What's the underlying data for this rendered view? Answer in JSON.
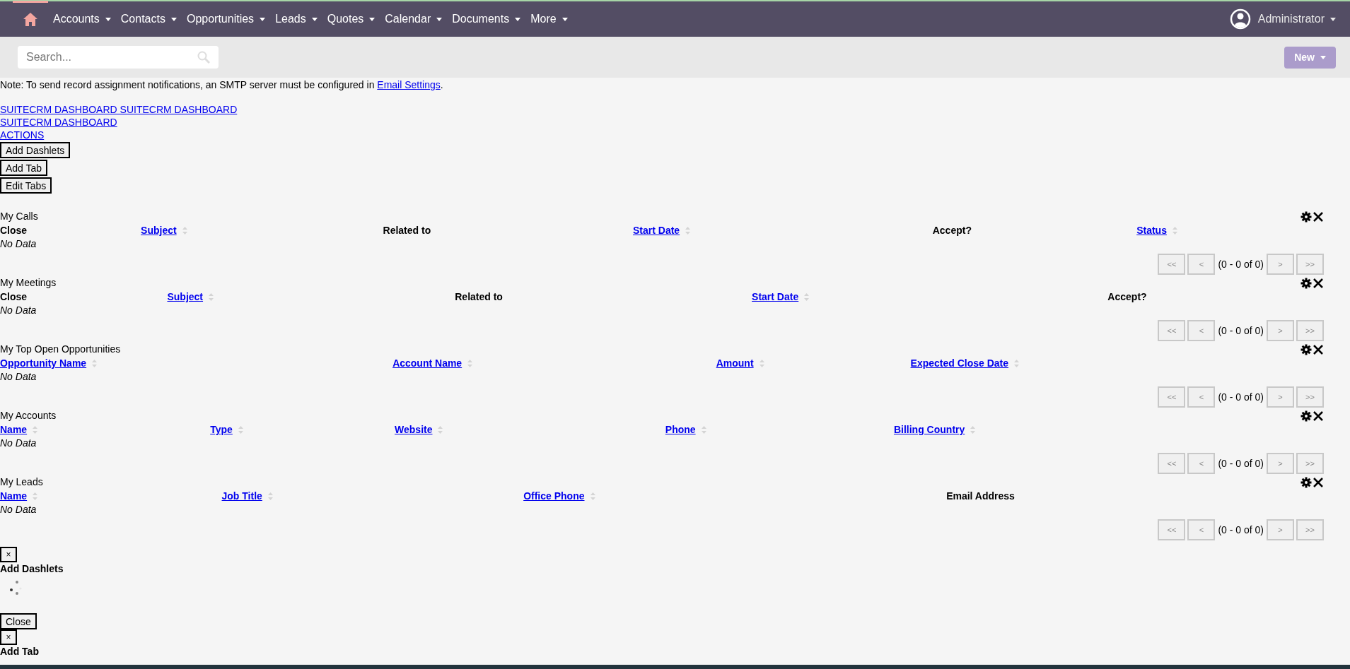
{
  "nav": {
    "items": [
      {
        "label": "Accounts"
      },
      {
        "label": "Contacts"
      },
      {
        "label": "Opportunities"
      },
      {
        "label": "Leads"
      },
      {
        "label": "Quotes"
      },
      {
        "label": "Calendar"
      },
      {
        "label": "Documents"
      },
      {
        "label": "More"
      }
    ],
    "user": "Administrator"
  },
  "toolbar": {
    "search": {
      "placeholder": "Search..."
    },
    "new_button": "New"
  },
  "notice": {
    "text": "Note: To send record assignment notifications, an SMTP server must be configured in ",
    "link": "Email Settings",
    "end": "."
  },
  "links": [
    "SUITECRM DASHBOARD SUITECRM DASHBOARD",
    "SUITECRM DASHBOARD",
    "ACTIONS"
  ],
  "buttons": [
    "Add Dashlets",
    "Add Tab",
    "Edit Tabs"
  ],
  "dashlets": [
    {
      "title": "My Calls",
      "columns": [
        {
          "label": "Close",
          "kind": "plain"
        },
        {
          "label": "Subject",
          "kind": "sortable"
        },
        {
          "label": "Related to",
          "kind": "plain"
        },
        {
          "label": "Start Date",
          "kind": "sortable"
        },
        {
          "label": "Accept?",
          "kind": "plain"
        },
        {
          "label": "Status",
          "kind": "sortable"
        }
      ],
      "empty": "No Data",
      "pager": {
        "first": "<<",
        "prev": "<",
        "range": "(0 - 0 of 0)",
        "next": ">",
        "last": ">>"
      }
    },
    {
      "title": "My Meetings",
      "columns": [
        {
          "label": "Close",
          "kind": "plain"
        },
        {
          "label": "Subject",
          "kind": "sortable"
        },
        {
          "label": "Related to",
          "kind": "plain"
        },
        {
          "label": "Start Date",
          "kind": "sortable"
        },
        {
          "label": "Accept?",
          "kind": "plain"
        }
      ],
      "empty": "No Data",
      "pager": {
        "first": "<<",
        "prev": "<",
        "range": "(0 - 0 of 0)",
        "next": ">",
        "last": ">>"
      }
    },
    {
      "title": "My Top Open Opportunities",
      "columns": [
        {
          "label": "Opportunity Name",
          "kind": "sortable"
        },
        {
          "label": "Account Name",
          "kind": "sortable"
        },
        {
          "label": "Amount",
          "kind": "sortable"
        },
        {
          "label": "Expected Close Date",
          "kind": "sortable"
        }
      ],
      "empty": "No Data",
      "pager": {
        "first": "<<",
        "prev": "<",
        "range": "(0 - 0 of 0)",
        "next": ">",
        "last": ">>"
      }
    },
    {
      "title": "My Accounts",
      "columns": [
        {
          "label": "Name",
          "kind": "sortable"
        },
        {
          "label": "Type",
          "kind": "sortable"
        },
        {
          "label": "Website",
          "kind": "sortable"
        },
        {
          "label": "Phone",
          "kind": "sortable"
        },
        {
          "label": "Billing Country",
          "kind": "sortable"
        }
      ],
      "empty": "No Data",
      "pager": {
        "first": "<<",
        "prev": "<",
        "range": "(0 - 0 of 0)",
        "next": ">",
        "last": ">>"
      }
    },
    {
      "title": "My Leads",
      "columns": [
        {
          "label": "Name",
          "kind": "sortable"
        },
        {
          "label": "Job Title",
          "kind": "sortable"
        },
        {
          "label": "Office Phone",
          "kind": "sortable"
        },
        {
          "label": "Email Address",
          "kind": "plain"
        }
      ],
      "empty": "No Data",
      "pager": {
        "first": "<<",
        "prev": "<",
        "range": "(0 - 0 of 0)",
        "next": ">",
        "last": ">>"
      }
    }
  ],
  "dialogs": [
    {
      "close": "×",
      "title": "Add Dashlets",
      "button": "Close"
    },
    {
      "close": "×",
      "title": "Add Tab"
    }
  ]
}
